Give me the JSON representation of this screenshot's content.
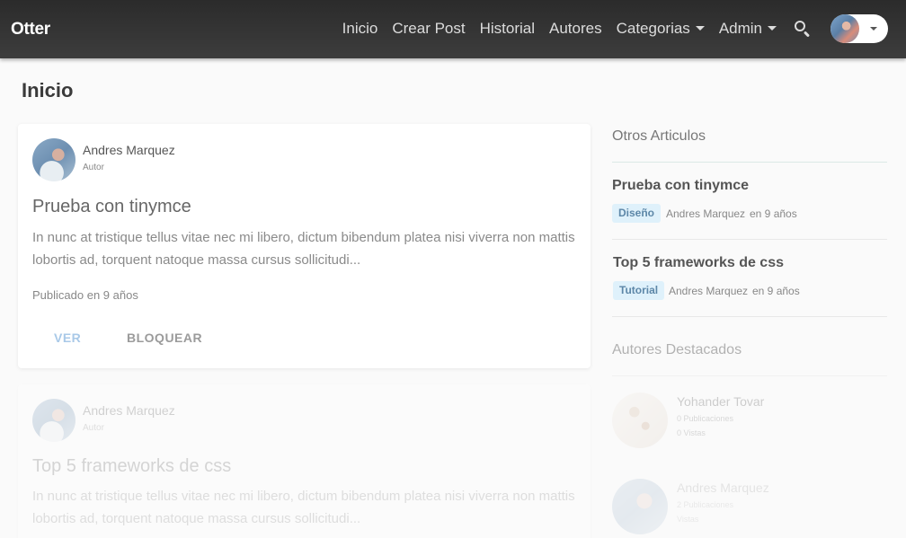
{
  "navbar": {
    "brand": "Otter",
    "links": [
      "Inicio",
      "Crear Post",
      "Historial",
      "Autores"
    ],
    "dropdowns": [
      "Categorias",
      "Admin"
    ]
  },
  "page": {
    "title": "Inicio"
  },
  "posts": [
    {
      "author": "Andres Marquez",
      "role": "Autor",
      "title": "Prueba con tinymce",
      "excerpt": "In nunc at tristique tellus vitae nec mi libero, dictum bibendum platea nisi viverra non mattis lobortis ad, torquent natoque massa cursus sollicitudi...",
      "date": "Publicado en 9 años",
      "view_label": "VER",
      "block_label": "BLOQUEAR"
    },
    {
      "author": "Andres Marquez",
      "role": "Autor",
      "title": "Top 5 frameworks de css",
      "excerpt": "In nunc at tristique tellus vitae nec mi libero, dictum bibendum platea nisi viverra non mattis lobortis ad, torquent natoque massa cursus sollicitudi..."
    }
  ],
  "sidebar": {
    "other_heading": "Otros Articulos",
    "articles": [
      {
        "title": "Prueba con tinymce",
        "tag": "Diseño",
        "author": "Andres Marquez",
        "when": "en 9 años"
      },
      {
        "title": "Top 5 frameworks de css",
        "tag": "Tutorial",
        "author": "Andres Marquez",
        "when": "en 9 años"
      }
    ],
    "featured_heading": "Autores Destacados",
    "featured": [
      {
        "name": "Yohander Tovar",
        "pubs": "0 Publicaciones",
        "views": "0 Vistas"
      },
      {
        "name": "Andres Marquez",
        "pubs": "2 Publicaciones",
        "views": "Vistas"
      }
    ]
  },
  "colors": {
    "navbar": "#333333",
    "tag_bg": "#dff1fb",
    "tag_text": "#5d87a8",
    "ver_button": "#a9c9e8"
  }
}
